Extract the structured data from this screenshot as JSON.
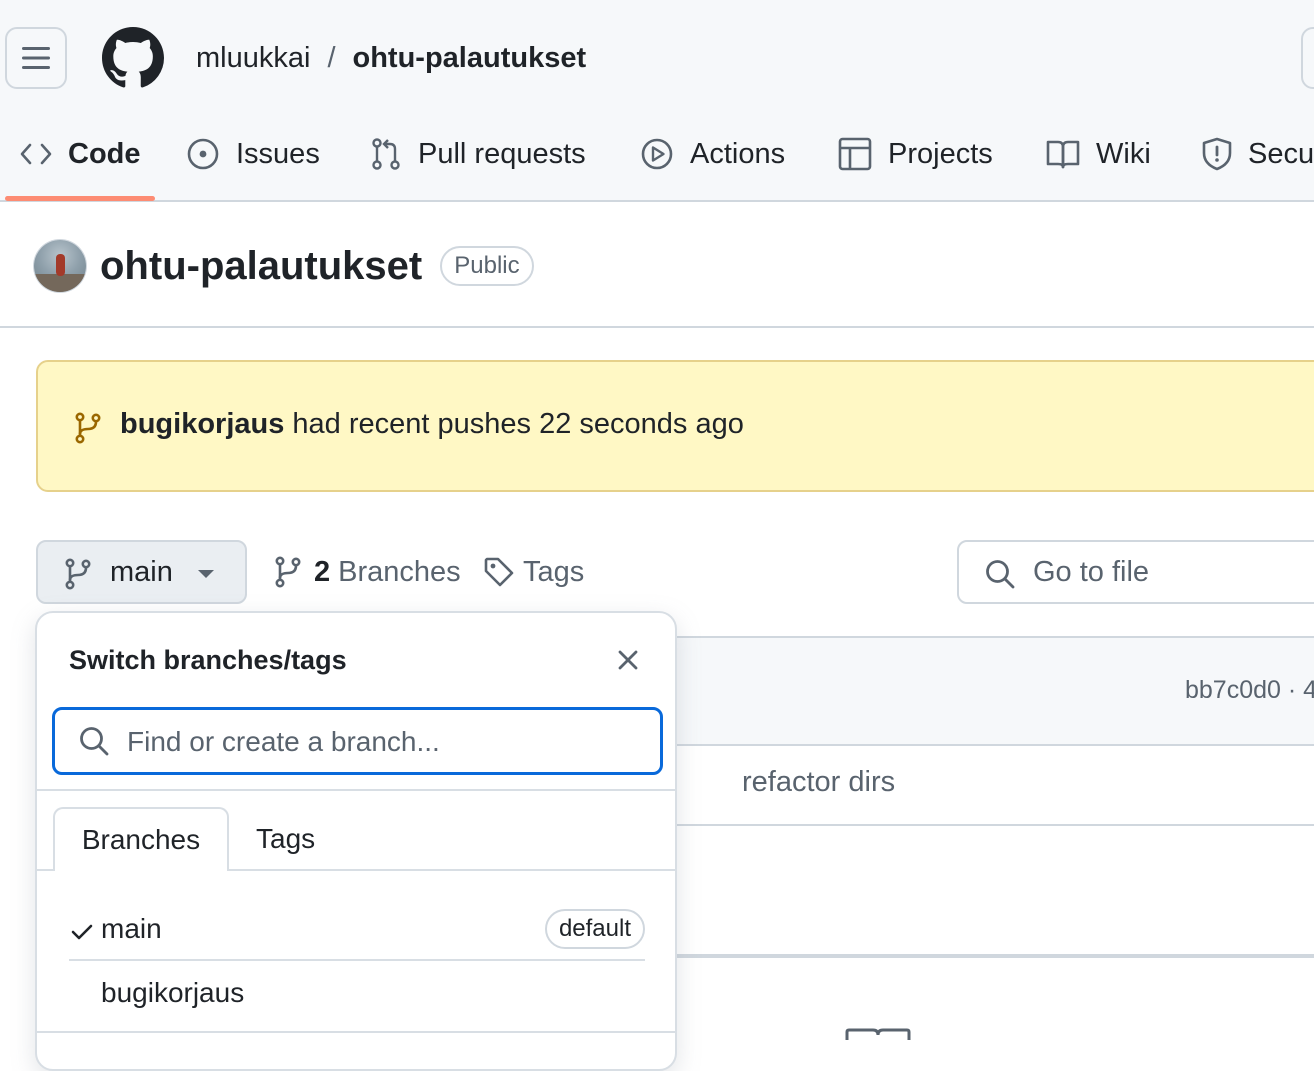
{
  "header": {
    "owner": "mluukkai",
    "separator": "/",
    "repo": "ohtu-palautukset"
  },
  "nav": {
    "tabs": [
      {
        "label": "Code",
        "icon": "code-icon",
        "active": true
      },
      {
        "label": "Issues",
        "icon": "issue-opened-icon"
      },
      {
        "label": "Pull requests",
        "icon": "git-pull-request-icon"
      },
      {
        "label": "Actions",
        "icon": "play-icon"
      },
      {
        "label": "Projects",
        "icon": "table-icon"
      },
      {
        "label": "Wiki",
        "icon": "book-icon"
      },
      {
        "label": "Secu",
        "icon": "shield-icon"
      }
    ],
    "active_color": "#fd8c73"
  },
  "repo": {
    "title": "ohtu-palautukset",
    "visibility": "Public"
  },
  "banner": {
    "branch": "bugikorjaus",
    "message": "had recent pushes 22 seconds ago",
    "background": "#fff8c5"
  },
  "toolbar": {
    "current_branch": "main",
    "branches_count": "2",
    "branches_label": "Branches",
    "tags_label": "Tags",
    "goto_placeholder": "Go to file"
  },
  "background": {
    "commit_hash": "bb7c0d0 · 4",
    "commit_message": "refactor dirs"
  },
  "dropdown": {
    "title": "Switch branches/tags",
    "search_placeholder": "Find or create a branch...",
    "tabs": [
      "Branches",
      "Tags"
    ],
    "items": [
      {
        "name": "main",
        "checked": true,
        "badge": "default"
      },
      {
        "name": "bugikorjaus",
        "checked": false
      }
    ],
    "focus_color": "#0969da"
  }
}
